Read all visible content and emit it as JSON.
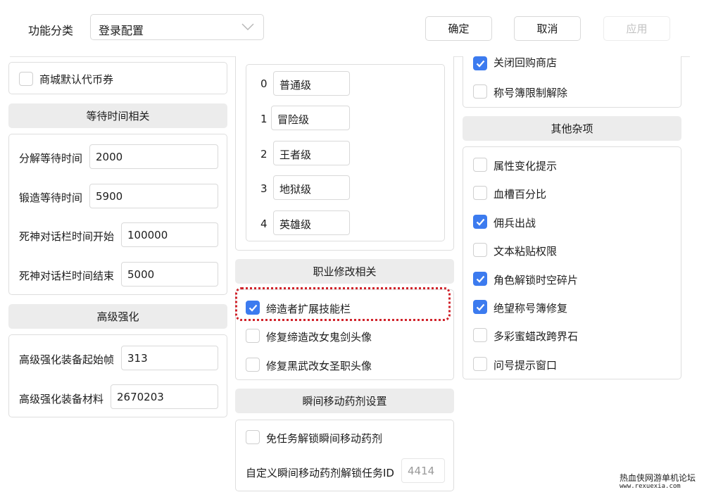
{
  "toolbar": {
    "category_label": "功能分类",
    "category_value": "登录配置",
    "confirm": "确定",
    "cancel": "取消",
    "apply": "应用"
  },
  "left": {
    "mall_coupon": {
      "label": "商城默认代币券",
      "checked": false
    },
    "wait_header": "等待时间相关",
    "wait_fields": [
      {
        "label": "分解等待时间",
        "value": "2000"
      },
      {
        "label": "锻造等待时间",
        "value": "5900"
      },
      {
        "label": "死神对话栏时间开始",
        "value": "100000"
      },
      {
        "label": "死神对话栏时间结束",
        "value": "5000"
      }
    ],
    "adv_header": "高级强化",
    "adv_fields": [
      {
        "label": "高级强化装备起始帧",
        "value": "313"
      },
      {
        "label": "高级强化装备材料",
        "value": "2670203"
      }
    ]
  },
  "middle": {
    "levels": [
      {
        "index": "0",
        "name": "普通级"
      },
      {
        "index": "1",
        "name": "冒险级"
      },
      {
        "index": "2",
        "name": "王者级"
      },
      {
        "index": "3",
        "name": "地狱级"
      },
      {
        "index": "4",
        "name": "英雄级"
      }
    ],
    "job_header": "职业修改相关",
    "job_items": [
      {
        "label": "缔造者扩展技能栏",
        "checked": true
      },
      {
        "label": "修复缔造改女鬼剑头像",
        "checked": false
      },
      {
        "label": "修复黑武改女圣职头像",
        "checked": false
      }
    ],
    "teleport_header": "瞬间移动药剂设置",
    "teleport_free": {
      "label": "免任务解锁瞬间移动药剂",
      "checked": false
    },
    "teleport_custom": {
      "label": "自定义瞬间移动药剂解锁任务ID",
      "value": "4414"
    }
  },
  "right": {
    "top_items": [
      {
        "label": "关闭回购商店",
        "checked": true
      },
      {
        "label": "称号簿限制解除",
        "checked": false
      }
    ],
    "misc_header": "其他杂项",
    "misc_items": [
      {
        "label": "属性变化提示",
        "checked": false
      },
      {
        "label": "血槽百分比",
        "checked": false
      },
      {
        "label": "佣兵出战",
        "checked": true
      },
      {
        "label": "文本粘贴权限",
        "checked": false
      },
      {
        "label": "角色解锁时空碎片",
        "checked": true
      },
      {
        "label": "绝望称号簿修复",
        "checked": true
      },
      {
        "label": "多彩蜜蜡改跨界石",
        "checked": false
      },
      {
        "label": "问号提示窗口",
        "checked": false
      }
    ]
  },
  "watermark": {
    "line1": "热血侠网游单机论坛",
    "line2": "www.rexuexia.com"
  },
  "colors": {
    "checkbox_on": "#3c7bef",
    "highlight": "#d0222a",
    "header_bg": "#ececec"
  }
}
